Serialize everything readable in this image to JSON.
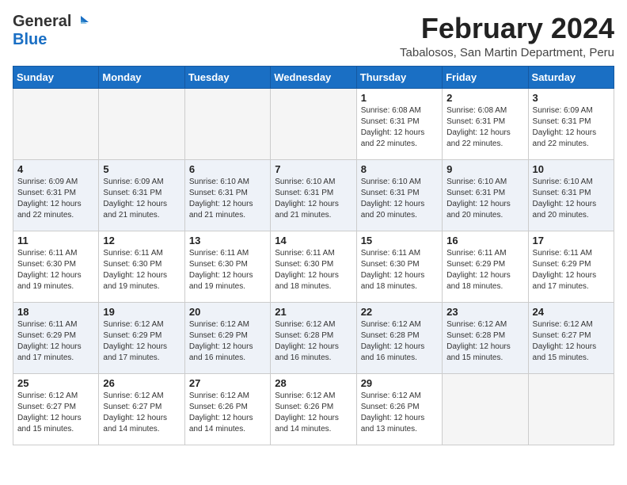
{
  "logo": {
    "general": "General",
    "blue": "Blue"
  },
  "header": {
    "month": "February 2024",
    "location": "Tabalosos, San Martin Department, Peru"
  },
  "days_of_week": [
    "Sunday",
    "Monday",
    "Tuesday",
    "Wednesday",
    "Thursday",
    "Friday",
    "Saturday"
  ],
  "weeks": [
    [
      {
        "day": "",
        "info": ""
      },
      {
        "day": "",
        "info": ""
      },
      {
        "day": "",
        "info": ""
      },
      {
        "day": "",
        "info": ""
      },
      {
        "day": "1",
        "info": "Sunrise: 6:08 AM\nSunset: 6:31 PM\nDaylight: 12 hours\nand 22 minutes."
      },
      {
        "day": "2",
        "info": "Sunrise: 6:08 AM\nSunset: 6:31 PM\nDaylight: 12 hours\nand 22 minutes."
      },
      {
        "day": "3",
        "info": "Sunrise: 6:09 AM\nSunset: 6:31 PM\nDaylight: 12 hours\nand 22 minutes."
      }
    ],
    [
      {
        "day": "4",
        "info": "Sunrise: 6:09 AM\nSunset: 6:31 PM\nDaylight: 12 hours\nand 22 minutes."
      },
      {
        "day": "5",
        "info": "Sunrise: 6:09 AM\nSunset: 6:31 PM\nDaylight: 12 hours\nand 21 minutes."
      },
      {
        "day": "6",
        "info": "Sunrise: 6:10 AM\nSunset: 6:31 PM\nDaylight: 12 hours\nand 21 minutes."
      },
      {
        "day": "7",
        "info": "Sunrise: 6:10 AM\nSunset: 6:31 PM\nDaylight: 12 hours\nand 21 minutes."
      },
      {
        "day": "8",
        "info": "Sunrise: 6:10 AM\nSunset: 6:31 PM\nDaylight: 12 hours\nand 20 minutes."
      },
      {
        "day": "9",
        "info": "Sunrise: 6:10 AM\nSunset: 6:31 PM\nDaylight: 12 hours\nand 20 minutes."
      },
      {
        "day": "10",
        "info": "Sunrise: 6:10 AM\nSunset: 6:31 PM\nDaylight: 12 hours\nand 20 minutes."
      }
    ],
    [
      {
        "day": "11",
        "info": "Sunrise: 6:11 AM\nSunset: 6:30 PM\nDaylight: 12 hours\nand 19 minutes."
      },
      {
        "day": "12",
        "info": "Sunrise: 6:11 AM\nSunset: 6:30 PM\nDaylight: 12 hours\nand 19 minutes."
      },
      {
        "day": "13",
        "info": "Sunrise: 6:11 AM\nSunset: 6:30 PM\nDaylight: 12 hours\nand 19 minutes."
      },
      {
        "day": "14",
        "info": "Sunrise: 6:11 AM\nSunset: 6:30 PM\nDaylight: 12 hours\nand 18 minutes."
      },
      {
        "day": "15",
        "info": "Sunrise: 6:11 AM\nSunset: 6:30 PM\nDaylight: 12 hours\nand 18 minutes."
      },
      {
        "day": "16",
        "info": "Sunrise: 6:11 AM\nSunset: 6:29 PM\nDaylight: 12 hours\nand 18 minutes."
      },
      {
        "day": "17",
        "info": "Sunrise: 6:11 AM\nSunset: 6:29 PM\nDaylight: 12 hours\nand 17 minutes."
      }
    ],
    [
      {
        "day": "18",
        "info": "Sunrise: 6:11 AM\nSunset: 6:29 PM\nDaylight: 12 hours\nand 17 minutes."
      },
      {
        "day": "19",
        "info": "Sunrise: 6:12 AM\nSunset: 6:29 PM\nDaylight: 12 hours\nand 17 minutes."
      },
      {
        "day": "20",
        "info": "Sunrise: 6:12 AM\nSunset: 6:29 PM\nDaylight: 12 hours\nand 16 minutes."
      },
      {
        "day": "21",
        "info": "Sunrise: 6:12 AM\nSunset: 6:28 PM\nDaylight: 12 hours\nand 16 minutes."
      },
      {
        "day": "22",
        "info": "Sunrise: 6:12 AM\nSunset: 6:28 PM\nDaylight: 12 hours\nand 16 minutes."
      },
      {
        "day": "23",
        "info": "Sunrise: 6:12 AM\nSunset: 6:28 PM\nDaylight: 12 hours\nand 15 minutes."
      },
      {
        "day": "24",
        "info": "Sunrise: 6:12 AM\nSunset: 6:27 PM\nDaylight: 12 hours\nand 15 minutes."
      }
    ],
    [
      {
        "day": "25",
        "info": "Sunrise: 6:12 AM\nSunset: 6:27 PM\nDaylight: 12 hours\nand 15 minutes."
      },
      {
        "day": "26",
        "info": "Sunrise: 6:12 AM\nSunset: 6:27 PM\nDaylight: 12 hours\nand 14 minutes."
      },
      {
        "day": "27",
        "info": "Sunrise: 6:12 AM\nSunset: 6:26 PM\nDaylight: 12 hours\nand 14 minutes."
      },
      {
        "day": "28",
        "info": "Sunrise: 6:12 AM\nSunset: 6:26 PM\nDaylight: 12 hours\nand 14 minutes."
      },
      {
        "day": "29",
        "info": "Sunrise: 6:12 AM\nSunset: 6:26 PM\nDaylight: 12 hours\nand 13 minutes."
      },
      {
        "day": "",
        "info": ""
      },
      {
        "day": "",
        "info": ""
      }
    ]
  ]
}
